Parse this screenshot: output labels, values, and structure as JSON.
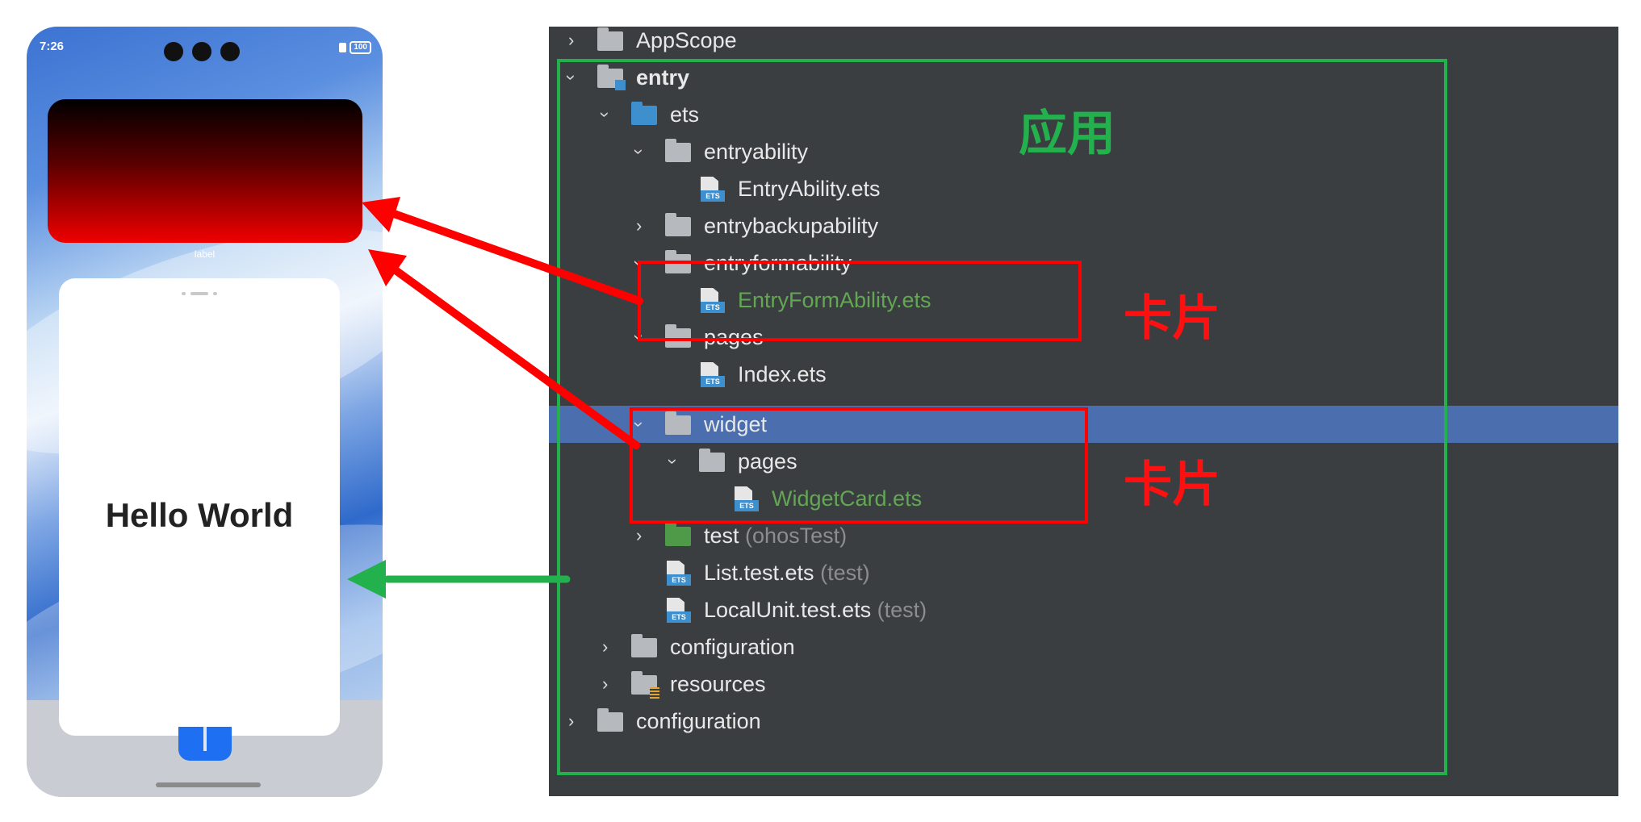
{
  "phone": {
    "status_time": "7:26",
    "battery": "100",
    "card_label": "label",
    "widget_text": "Hello World",
    "gradient_colors": [
      "#000000",
      "#f00000"
    ]
  },
  "tree": {
    "rows": [
      {
        "name": "AppScope"
      },
      {
        "name": "entry"
      },
      {
        "name": "ets"
      },
      {
        "name": "entryability"
      },
      {
        "name": "EntryAbility.ets"
      },
      {
        "name": "entrybackupability"
      },
      {
        "name": "entryformability"
      },
      {
        "name": "EntryFormAbility.ets"
      },
      {
        "name": "pages"
      },
      {
        "name": "Index.ets"
      },
      {
        "name": "widget"
      },
      {
        "name": "pages"
      },
      {
        "name": "WidgetCard.ets"
      },
      {
        "name": "test",
        "hint": "(ohosTest)"
      },
      {
        "name": "List.test.ets",
        "hint": "(test)"
      },
      {
        "name": "LocalUnit.test.ets",
        "hint": "(test)"
      },
      {
        "name": "configuration"
      },
      {
        "name": "resources"
      },
      {
        "name": "configuration"
      }
    ],
    "file_tag": "ETS"
  },
  "annotations": {
    "app_label": "应用",
    "card_label_1": "卡片",
    "card_label_2": "卡片",
    "colors": {
      "app": "#22b14c",
      "card": "#ff0000",
      "selection": "#4b6eaf",
      "panel": "#3b3e41"
    }
  }
}
